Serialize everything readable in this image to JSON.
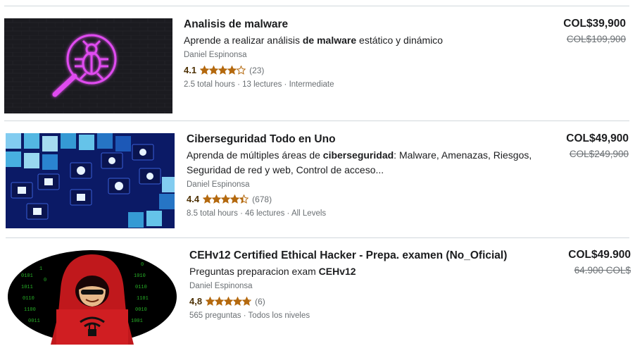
{
  "courses": [
    {
      "title": "Analisis de malware",
      "desc_parts": [
        "Aprende a realizar análisis ",
        "de malware",
        " estático y dinámico"
      ],
      "author": "Daniel Espinonsa",
      "rating": "4.1",
      "rating_value": 4.1,
      "reviews": "(23)",
      "meta": "2.5 total hours · 13 lectures · Intermediate",
      "price": "COL$39,900",
      "old_price": "COL$109,900",
      "thumb_icon": "magnifier-bug-icon"
    },
    {
      "title": "Ciberseguridad Todo en Uno",
      "desc_parts": [
        "Aprenda de múltiples áreas de ",
        "ciberseguridad",
        ": Malware, Amenazas, Riesgos, Seguridad de red y web, Control de acceso..."
      ],
      "author": "Daniel Espinonsa",
      "rating": "4.4",
      "rating_value": 4.4,
      "reviews": "(678)",
      "meta": "8.5 total hours · 46 lectures · All Levels",
      "price": "COL$49,900",
      "old_price": "COL$249,900",
      "thumb_icon": "security-tiles-icon"
    },
    {
      "title": "CEHv12 Certified Ethical Hacker - Prepa. examen (No_Oficial)",
      "desc_parts": [
        "Preguntas preparacion exam ",
        "CEHv12",
        ""
      ],
      "author": "Daniel Espinonsa",
      "rating": "4,8",
      "rating_value": 4.8,
      "reviews": "(6)",
      "meta": "565 preguntas · Todos los niveles",
      "price": "COL$49.900",
      "old_price": "64.900 COL$",
      "thumb_icon": "hooded-hacker-icon"
    }
  ],
  "colors": {
    "star": "#b4690e",
    "rating_text": "#4d3105",
    "muted": "#6a6f73",
    "divider": "#d1d7dc"
  }
}
